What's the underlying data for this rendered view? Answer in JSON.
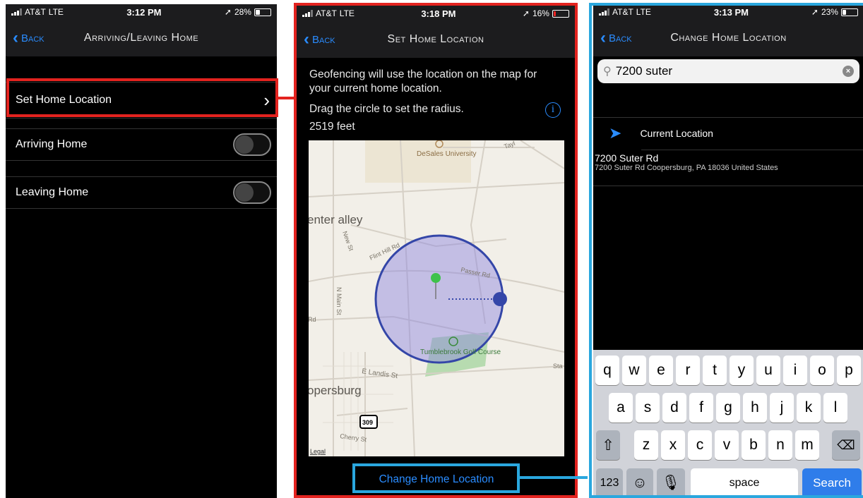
{
  "screen1": {
    "status": {
      "carrier": "AT&T",
      "network": "LTE",
      "time": "3:12 PM",
      "battery": "28%"
    },
    "nav": {
      "back": "Back",
      "title": "Arriving/Leaving Home"
    },
    "rows": [
      {
        "label": "Set Home Location",
        "chevron": "›"
      },
      {
        "label": "Arriving Home",
        "toggle": false
      },
      {
        "label": "Leaving Home",
        "toggle": false
      }
    ]
  },
  "screen2": {
    "status": {
      "carrier": "AT&T",
      "network": "LTE",
      "time": "3:18 PM",
      "battery": "16%"
    },
    "nav": {
      "back": "Back",
      "title": "Set Home Location"
    },
    "description_1": "Geofencing will use the location on the map for your current home location.",
    "description_2": "Drag the circle to set the radius.",
    "radius": "2519 feet",
    "info_icon": "i",
    "map": {
      "labels": {
        "university": "DeSales University",
        "center_valley": "enter alley",
        "new_st": "New St",
        "flint_hill": "Flint Hill Rd",
        "passer": "Passer Rd",
        "main_st": "N Main St",
        "rd": "Rd",
        "golf": "Tumblebrook Golf Course",
        "landis": "E Landis St",
        "coopersburg": "opersburg",
        "route": "309",
        "cherry": "Cherry St",
        "legal": "Legal",
        "taylor": "Tayl",
        "sta": "Sta"
      }
    },
    "change_button": "Change Home Location"
  },
  "screen3": {
    "status": {
      "carrier": "AT&T",
      "network": "LTE",
      "time": "3:13 PM",
      "battery": "23%"
    },
    "nav": {
      "back": "Back",
      "title": "Change Home Location"
    },
    "search": {
      "value": "7200 suter"
    },
    "results": [
      {
        "title": "Current Location",
        "subtitle": ""
      },
      {
        "title": "7200 Suter Rd",
        "subtitle": "7200 Suter Rd Coopersburg, PA  18036 United States"
      }
    ],
    "keyboard": {
      "row1": [
        "q",
        "w",
        "e",
        "r",
        "t",
        "y",
        "u",
        "i",
        "o",
        "p"
      ],
      "row2": [
        "a",
        "s",
        "d",
        "f",
        "g",
        "h",
        "j",
        "k",
        "l"
      ],
      "row3": [
        "z",
        "x",
        "c",
        "v",
        "b",
        "n",
        "m"
      ],
      "numbers": "123",
      "space": "space",
      "search": "Search"
    }
  },
  "colors": {
    "highlight_red": "#e3231f",
    "highlight_blue": "#2aa7de",
    "ios_blue": "#2a8cff"
  }
}
